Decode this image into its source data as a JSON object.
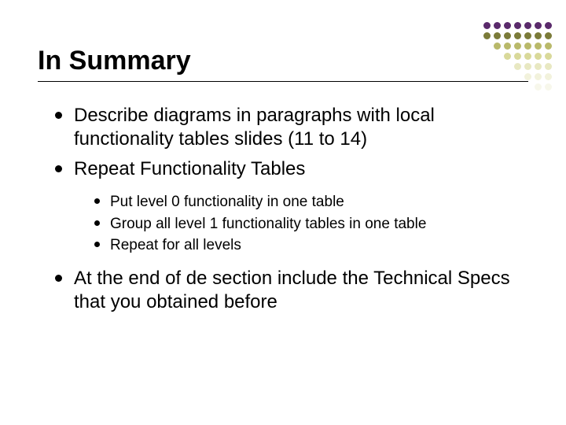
{
  "title": "In Summary",
  "bullets": {
    "b1": "Describe diagrams in paragraphs with local functionality tables slides (11 to 14)",
    "b2": "Repeat Functionality Tables",
    "b3": "At the end of de section include the Technical Specs that you obtained before"
  },
  "sub": {
    "s1": "Put level 0 functionality in one table",
    "s2": "Group all level 1 functionality tables in one table",
    "s3": "Repeat for all levels"
  },
  "decor": {
    "colors": [
      "#5a2a6b",
      "#7b7b39",
      "#b9b96a",
      "#d9d99a"
    ]
  }
}
